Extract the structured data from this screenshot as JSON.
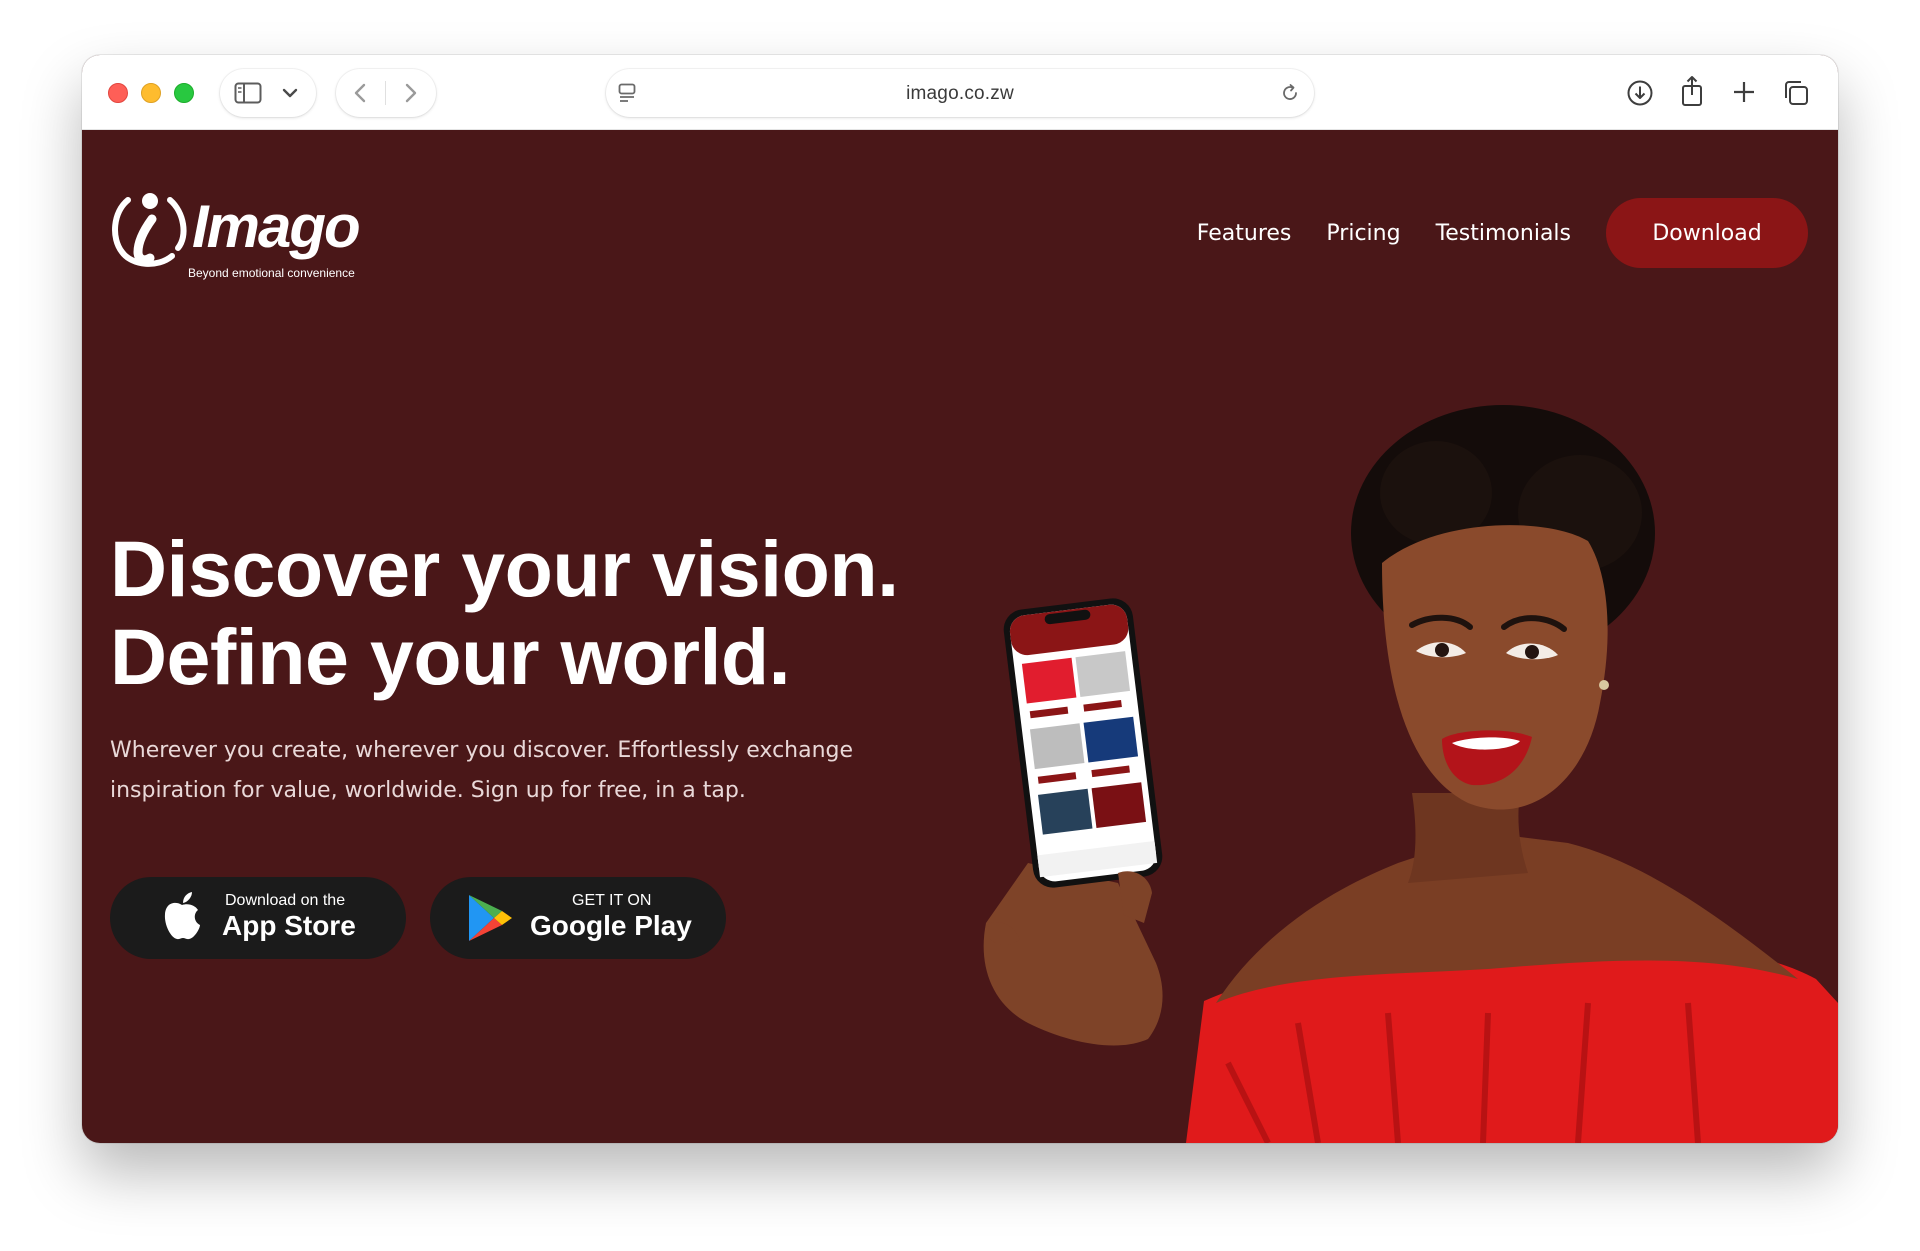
{
  "browser": {
    "url": "imago.co.zw",
    "icons": [
      "sidebar-icon",
      "chevron-down-icon",
      "back-icon",
      "forward-icon",
      "site-settings-icon",
      "reload-icon",
      "download-icon",
      "share-icon",
      "new-tab-icon",
      "tab-overview-icon"
    ]
  },
  "header": {
    "logo_text": "Imago",
    "logo_tagline": "Beyond emotional convenience",
    "nav": [
      "Features",
      "Pricing",
      "Testimonials"
    ],
    "download_label": "Download"
  },
  "hero": {
    "headline_line1": "Discover your vision.",
    "headline_line2": "Define your world.",
    "subtext": "Wherever you create, wherever you discover. Effortlessly exchange inspiration for value, worldwide. Sign up for free, in a tap.",
    "app_store": {
      "small": "Download on the",
      "big": "App Store"
    },
    "google_play": {
      "small": "GET IT ON",
      "big": "Google Play"
    }
  },
  "colors": {
    "page_background": "#4a1718",
    "accent": "#8b1516",
    "store_button": "#1b1b1b"
  }
}
